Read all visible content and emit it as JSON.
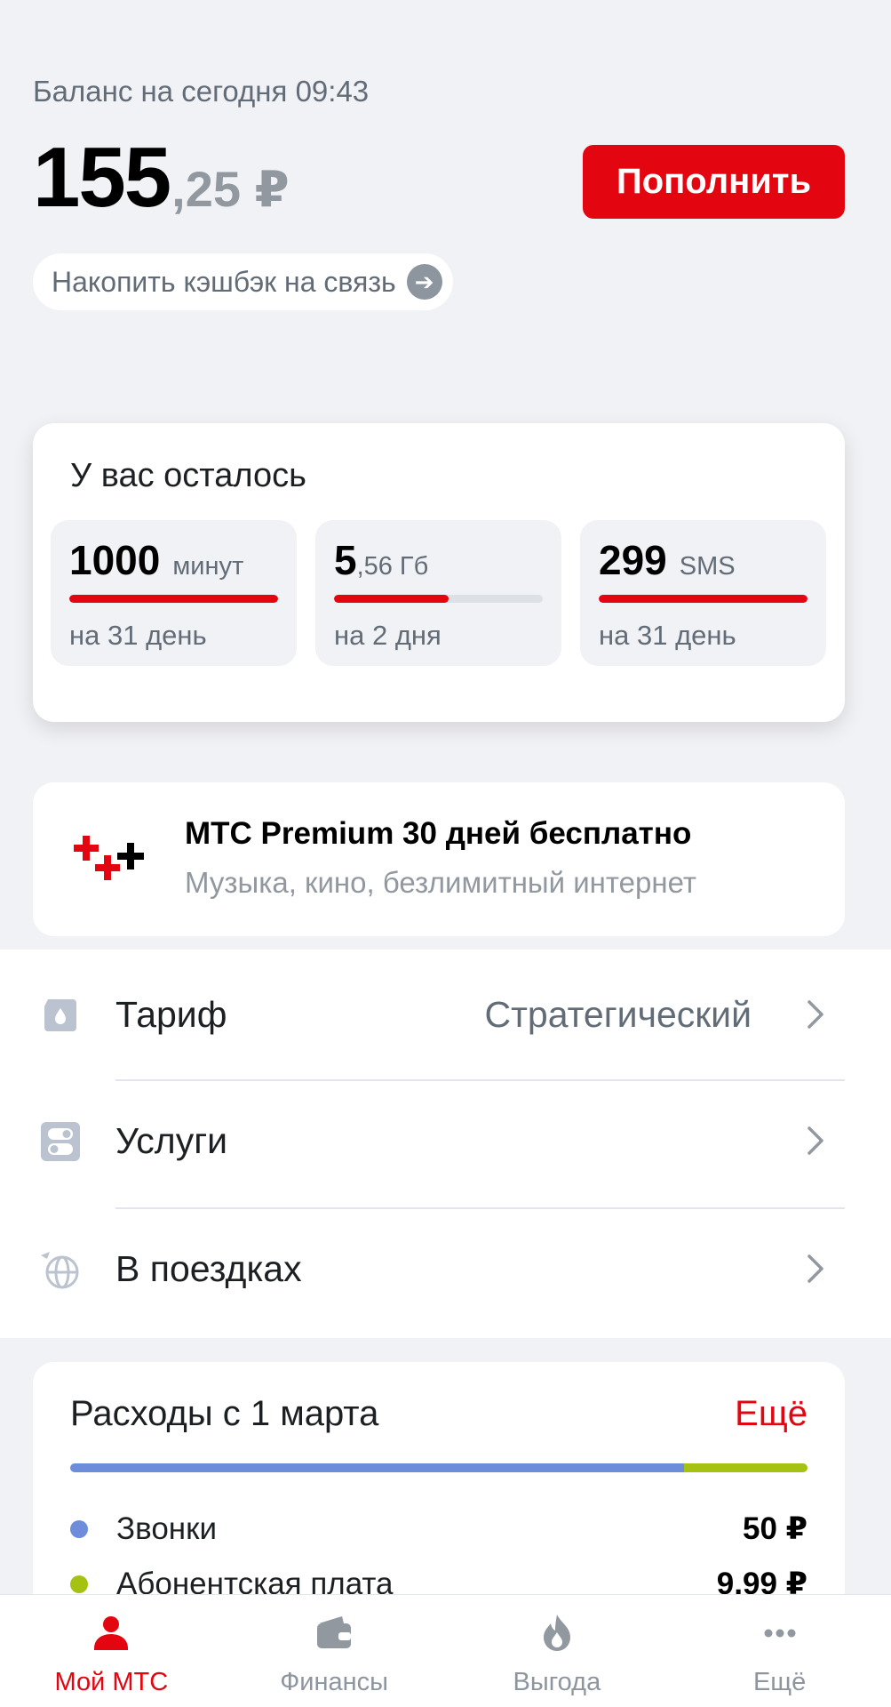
{
  "balance": {
    "label": "Баланс на сегодня 09:43",
    "amount_int": "155",
    "amount_frac": ",25 ₽",
    "topup_label": "Пополнить",
    "cashback_label": "Накопить кэшбэк на связь"
  },
  "remaining": {
    "title": "У вас осталось",
    "tiles": [
      {
        "value": "1000",
        "fraction": "",
        "unit": "минут",
        "period": "на 31 день",
        "fill_fraction": 1.0
      },
      {
        "value": "5",
        "fraction": ",56",
        "unit": "Гб",
        "period": "на 2 дня",
        "fill_fraction": 0.55
      },
      {
        "value": "299",
        "fraction": "",
        "unit": "SMS",
        "period": "на 31 день",
        "fill_fraction": 1.0
      }
    ]
  },
  "promo": {
    "title": "МТС Premium 30 дней бесплатно",
    "subtitle": "Музыка, кино, безлимитный интернет"
  },
  "menu": [
    {
      "label": "Тариф",
      "value": "Стратегический",
      "icon": "sim-card-icon"
    },
    {
      "label": "Услуги",
      "value": "",
      "icon": "services-icon"
    },
    {
      "label": "В поездках",
      "value": "",
      "icon": "travel-globe-icon"
    }
  ],
  "expenses": {
    "title": "Расходы с 1 марта",
    "more_label": "Ещё",
    "items": [
      {
        "name": "Звонки",
        "amount": "50 ₽",
        "color": "#6d8ddb",
        "share": 0.833
      },
      {
        "name": "Абонентская плата",
        "amount": "9,99 ₽",
        "color": "#a5c213",
        "share": 0.167
      }
    ]
  },
  "tabs": [
    {
      "label": "Мой МТС",
      "icon": "person-icon",
      "active": true
    },
    {
      "label": "Финансы",
      "icon": "wallet-icon",
      "active": false
    },
    {
      "label": "Выгода",
      "icon": "flame-icon",
      "active": false
    },
    {
      "label": "Ещё",
      "icon": "more-dots-icon",
      "active": false
    }
  ],
  "colors": {
    "accent": "#e30611",
    "background": "#f1f2f6",
    "muted_text": "#626c77"
  }
}
